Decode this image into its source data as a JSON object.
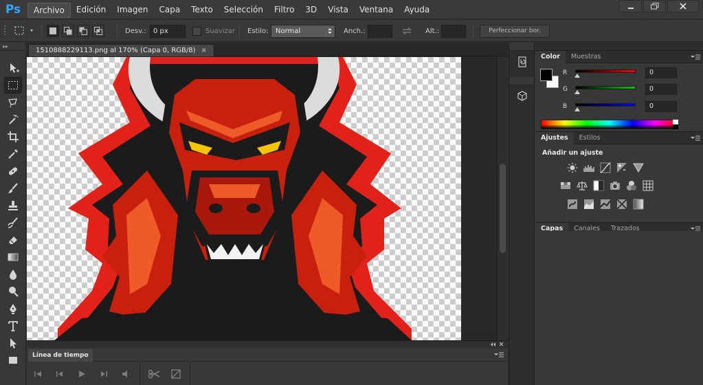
{
  "app": {
    "logo": "Ps",
    "menu": [
      "Archivo",
      "Edición",
      "Imagen",
      "Capa",
      "Texto",
      "Selección",
      "Filtro",
      "3D",
      "Vista",
      "Ventana",
      "Ayuda"
    ],
    "active_menu": "Archivo"
  },
  "options_bar": {
    "feather_label": "Desv.:",
    "feather_value": "0 px",
    "smooth_label": "Suavizar",
    "style_label": "Estilo:",
    "style_value": "Normal",
    "width_label": "Anch.:",
    "height_label": "Alt.:",
    "refine_button": "Perfeccionar bor."
  },
  "document": {
    "tab_title": "1510888229113.png al 170% (Capa 0, RGB/8)",
    "close_glyph": "×",
    "background": "transparent-checkerboard",
    "artwork": "red-bull-mascot"
  },
  "timeline": {
    "tab_label": "Línea de tiempo"
  },
  "panels": {
    "color": {
      "tabs": [
        "Color",
        "Muestras"
      ],
      "active_tab": "Color",
      "foreground": "#000000",
      "background": "#ffffff",
      "channels": [
        {
          "label": "R",
          "value": "0",
          "color": "#ff0000"
        },
        {
          "label": "G",
          "value": "0",
          "color": "#00cc00"
        },
        {
          "label": "B",
          "value": "0",
          "color": "#0000ff"
        }
      ]
    },
    "adjustments": {
      "tabs": [
        "Ajustes",
        "Estilos"
      ],
      "active_tab": "Ajustes",
      "title": "Añadir un ajuste"
    },
    "layers": {
      "tabs": [
        "Capas",
        "Canales",
        "Trazados"
      ],
      "active_tab": "Capas"
    }
  },
  "colors": {
    "ps_blue": "#31a8ff",
    "bull_red": "#c8200f",
    "bull_dark": "#1b1b1b",
    "horn": "#dcdcdc",
    "eye": "#f5c400"
  }
}
